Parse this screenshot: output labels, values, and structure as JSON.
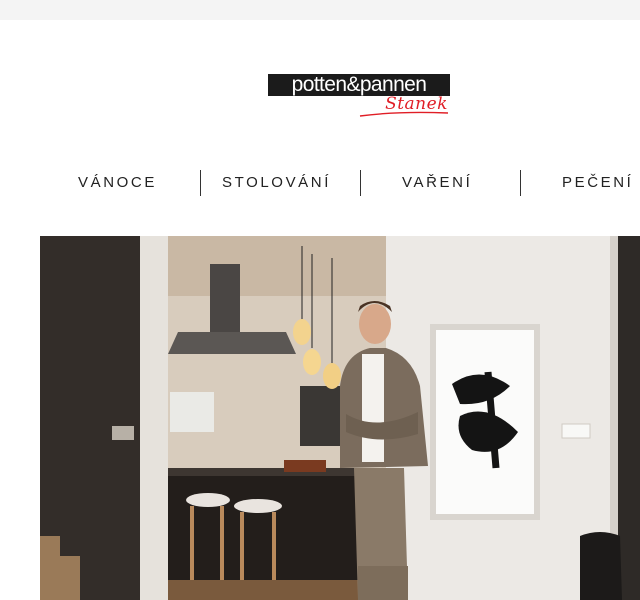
{
  "brand": {
    "logo_main": "potten&pannen",
    "logo_script": "Stanek"
  },
  "nav": {
    "items": [
      {
        "label": "VÁNOCE"
      },
      {
        "label": "STOLOVÁNÍ"
      },
      {
        "label": "VAŘENÍ"
      },
      {
        "label": "PEČENÍ"
      }
    ]
  },
  "colors": {
    "logo_background": "#1b1b1b",
    "logo_script": "#e01e26",
    "topbar": "#f4f4f4"
  }
}
